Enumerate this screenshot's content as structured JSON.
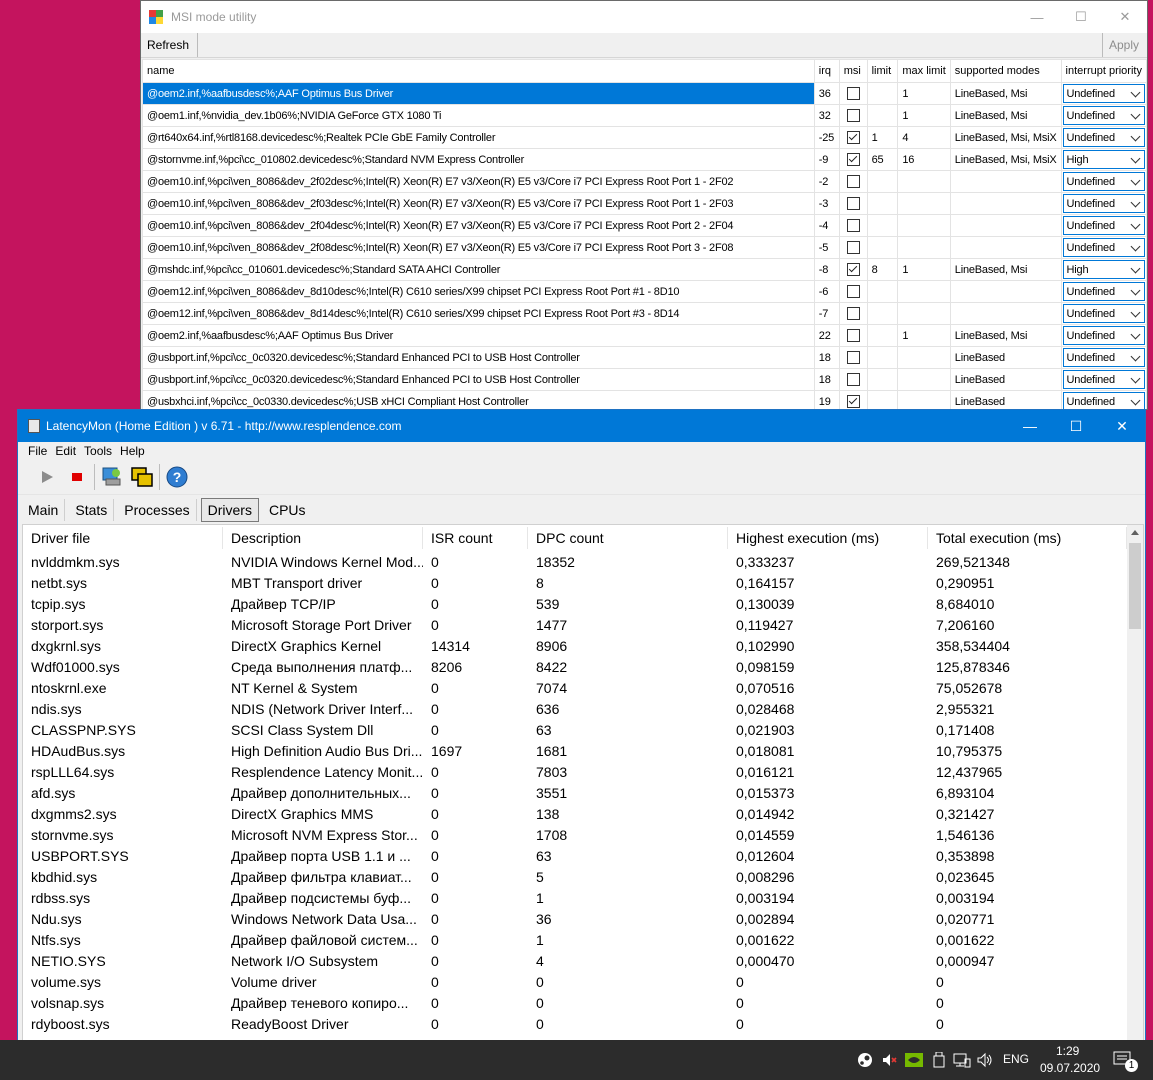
{
  "msi": {
    "title": "MSI mode utility",
    "refresh_label": "Refresh",
    "apply_label": "Apply",
    "columns": [
      "name",
      "irq",
      "msi",
      "limit",
      "max limit",
      "supported modes",
      "interrupt priority"
    ],
    "rows": [
      {
        "name": "@oem2.inf,%aafbusdesc%;AAF Optimus Bus Driver",
        "irq": "36",
        "msi": false,
        "limit": "",
        "max": "1",
        "modes": "LineBased, Msi",
        "priority": "Undefined"
      },
      {
        "name": "@oem1.inf,%nvidia_dev.1b06%;NVIDIA GeForce GTX 1080 Ti",
        "irq": "32",
        "msi": false,
        "limit": "",
        "max": "1",
        "modes": "LineBased, Msi",
        "priority": "Undefined"
      },
      {
        "name": "@rt640x64.inf,%rtl8168.devicedesc%;Realtek PCIe GbE Family Controller",
        "irq": "-25",
        "msi": true,
        "limit": "1",
        "max": "4",
        "modes": "LineBased, Msi, MsiX",
        "priority": "Undefined"
      },
      {
        "name": "@stornvme.inf,%pci\\cc_010802.devicedesc%;Standard NVM Express Controller",
        "irq": "-9",
        "msi": true,
        "limit": "65",
        "max": "16",
        "modes": "LineBased, Msi, MsiX",
        "priority": "High"
      },
      {
        "name": "@oem10.inf,%pci\\ven_8086&dev_2f02desc%;Intel(R) Xeon(R) E7 v3/Xeon(R) E5 v3/Core i7 PCI Express Root Port 1 - 2F02",
        "irq": "-2",
        "msi": false,
        "limit": "",
        "max": "",
        "modes": "",
        "priority": "Undefined"
      },
      {
        "name": "@oem10.inf,%pci\\ven_8086&dev_2f03desc%;Intel(R) Xeon(R) E7 v3/Xeon(R) E5 v3/Core i7 PCI Express Root Port 1 - 2F03",
        "irq": "-3",
        "msi": false,
        "limit": "",
        "max": "",
        "modes": "",
        "priority": "Undefined"
      },
      {
        "name": "@oem10.inf,%pci\\ven_8086&dev_2f04desc%;Intel(R) Xeon(R) E7 v3/Xeon(R) E5 v3/Core i7 PCI Express Root Port 2 - 2F04",
        "irq": "-4",
        "msi": false,
        "limit": "",
        "max": "",
        "modes": "",
        "priority": "Undefined"
      },
      {
        "name": "@oem10.inf,%pci\\ven_8086&dev_2f08desc%;Intel(R) Xeon(R) E7 v3/Xeon(R) E5 v3/Core i7 PCI Express Root Port 3 - 2F08",
        "irq": "-5",
        "msi": false,
        "limit": "",
        "max": "",
        "modes": "",
        "priority": "Undefined"
      },
      {
        "name": "@mshdc.inf,%pci\\cc_010601.devicedesc%;Standard SATA AHCI Controller",
        "irq": "-8",
        "msi": true,
        "limit": "8",
        "max": "1",
        "modes": "LineBased, Msi",
        "priority": "High"
      },
      {
        "name": "@oem12.inf,%pci\\ven_8086&dev_8d10desc%;Intel(R) C610 series/X99 chipset PCI Express Root Port #1 - 8D10",
        "irq": "-6",
        "msi": false,
        "limit": "",
        "max": "",
        "modes": "",
        "priority": "Undefined"
      },
      {
        "name": "@oem12.inf,%pci\\ven_8086&dev_8d14desc%;Intel(R) C610 series/X99 chipset PCI Express Root Port #3 - 8D14",
        "irq": "-7",
        "msi": false,
        "limit": "",
        "max": "",
        "modes": "",
        "priority": "Undefined"
      },
      {
        "name": "@oem2.inf,%aafbusdesc%;AAF Optimus Bus Driver",
        "irq": "22",
        "msi": false,
        "limit": "",
        "max": "1",
        "modes": "LineBased, Msi",
        "priority": "Undefined"
      },
      {
        "name": "@usbport.inf,%pci\\cc_0c0320.devicedesc%;Standard Enhanced PCI to USB Host Controller",
        "irq": "18",
        "msi": false,
        "limit": "",
        "max": "",
        "modes": "LineBased",
        "priority": "Undefined"
      },
      {
        "name": "@usbport.inf,%pci\\cc_0c0320.devicedesc%;Standard Enhanced PCI to USB Host Controller",
        "irq": "18",
        "msi": false,
        "limit": "",
        "max": "",
        "modes": "LineBased",
        "priority": "Undefined"
      },
      {
        "name": "@usbxhci.inf,%pci\\cc_0c0330.devicedesc%;USB xHCI Compliant Host Controller",
        "irq": "19",
        "msi": true,
        "limit": "",
        "max": "",
        "modes": "LineBased",
        "priority": "Undefined"
      }
    ]
  },
  "latency": {
    "title": "LatencyMon  (Home Edition )  v 6.71 - http://www.resplendence.com",
    "menu": [
      "File",
      "Edit",
      "Tools",
      "Help"
    ],
    "tabs": [
      "Main",
      "Stats",
      "Processes",
      "Drivers",
      "CPUs"
    ],
    "active_tab": "Drivers",
    "columns": [
      "Driver file",
      "Description",
      "ISR count",
      "DPC count",
      "Highest execution (ms)",
      "Total execution (ms)"
    ],
    "rows": [
      [
        "nvlddmkm.sys",
        "NVIDIA Windows Kernel Mod...",
        "0",
        "18352",
        "0,333237",
        "269,521348"
      ],
      [
        "netbt.sys",
        "MBT Transport driver",
        "0",
        "8",
        "0,164157",
        "0,290951"
      ],
      [
        "tcpip.sys",
        "Драйвер TCP/IP",
        "0",
        "539",
        "0,130039",
        "8,684010"
      ],
      [
        "storport.sys",
        "Microsoft Storage Port Driver",
        "0",
        "1477",
        "0,119427",
        "7,206160"
      ],
      [
        "dxgkrnl.sys",
        "DirectX Graphics Kernel",
        "14314",
        "8906",
        "0,102990",
        "358,534404"
      ],
      [
        "Wdf01000.sys",
        "Среда выполнения платф...",
        "8206",
        "8422",
        "0,098159",
        "125,878346"
      ],
      [
        "ntoskrnl.exe",
        "NT Kernel & System",
        "0",
        "7074",
        "0,070516",
        "75,052678"
      ],
      [
        "ndis.sys",
        "NDIS (Network Driver Interf...",
        "0",
        "636",
        "0,028468",
        "2,955321"
      ],
      [
        "CLASSPNP.SYS",
        "SCSI Class System Dll",
        "0",
        "63",
        "0,021903",
        "0,171408"
      ],
      [
        "HDAudBus.sys",
        "High Definition Audio Bus Dri...",
        "1697",
        "1681",
        "0,018081",
        "10,795375"
      ],
      [
        "rspLLL64.sys",
        "Resplendence Latency Monit...",
        "0",
        "7803",
        "0,016121",
        "12,437965"
      ],
      [
        "afd.sys",
        "Драйвер дополнительных...",
        "0",
        "3551",
        "0,015373",
        "6,893104"
      ],
      [
        "dxgmms2.sys",
        "DirectX Graphics MMS",
        "0",
        "138",
        "0,014942",
        "0,321427"
      ],
      [
        "stornvme.sys",
        "Microsoft NVM Express Stor...",
        "0",
        "1708",
        "0,014559",
        "1,546136"
      ],
      [
        "USBPORT.SYS",
        "Драйвер порта USB 1.1 и ...",
        "0",
        "63",
        "0,012604",
        "0,353898"
      ],
      [
        "kbdhid.sys",
        "Драйвер фильтра клавиат...",
        "0",
        "5",
        "0,008296",
        "0,023645"
      ],
      [
        "rdbss.sys",
        "Драйвер подсистемы буф...",
        "0",
        "1",
        "0,003194",
        "0,003194"
      ],
      [
        "Ndu.sys",
        "Windows Network Data Usa...",
        "0",
        "36",
        "0,002894",
        "0,020771"
      ],
      [
        "Ntfs.sys",
        "Драйвер файловой систем...",
        "0",
        "1",
        "0,001622",
        "0,001622"
      ],
      [
        "NETIO.SYS",
        "Network I/O Subsystem",
        "0",
        "4",
        "0,000470",
        "0,000947"
      ],
      [
        "volume.sys",
        "Volume driver",
        "0",
        "0",
        "0",
        "0"
      ],
      [
        "volsnap.sys",
        "Драйвер теневого копиро...",
        "0",
        "0",
        "0",
        "0"
      ],
      [
        "rdyboost.sys",
        "ReadyBoost Driver",
        "0",
        "0",
        "0",
        "0"
      ]
    ]
  },
  "taskbar": {
    "language": "ENG",
    "time": "1:29",
    "date": "09.07.2020",
    "notification_count": "1"
  },
  "colors": {
    "desktop": "#c4145e",
    "accent": "#0078d7",
    "taskbar": "#2c2c2c"
  }
}
